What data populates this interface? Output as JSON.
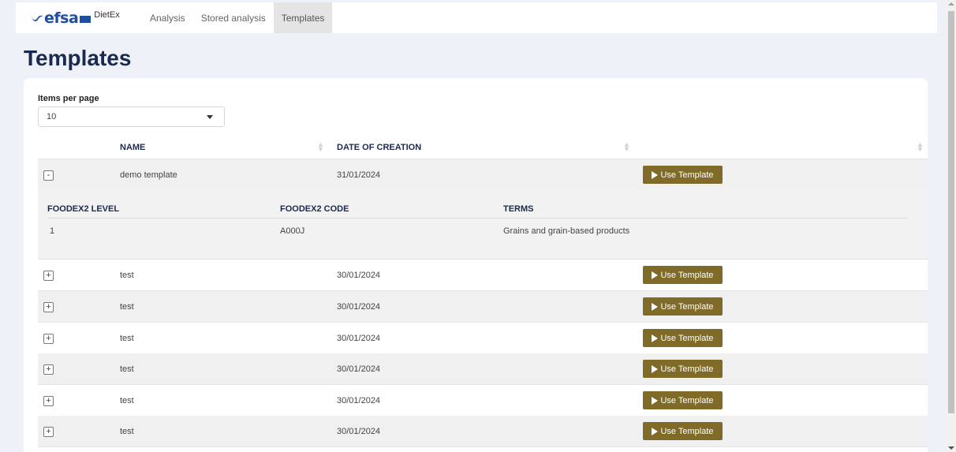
{
  "navbar": {
    "logo_text": "efsa",
    "app_name": "DietEx",
    "items": [
      {
        "label": "Analysis",
        "active": false
      },
      {
        "label": "Stored analysis",
        "active": false
      },
      {
        "label": "Templates",
        "active": true
      }
    ]
  },
  "page": {
    "title": "Templates"
  },
  "pager": {
    "label": "Items per page",
    "value": "10"
  },
  "table": {
    "columns": [
      "NAME",
      "DATE OF CREATION",
      ""
    ],
    "button_label": "Use Template",
    "rows": [
      {
        "toggle": "-",
        "name": "demo template",
        "date": "31/01/2024",
        "expanded": true
      },
      {
        "toggle": "+",
        "name": "test",
        "date": "30/01/2024",
        "expanded": false
      },
      {
        "toggle": "+",
        "name": "test",
        "date": "30/01/2024",
        "expanded": false
      },
      {
        "toggle": "+",
        "name": "test",
        "date": "30/01/2024",
        "expanded": false
      },
      {
        "toggle": "+",
        "name": "test",
        "date": "30/01/2024",
        "expanded": false
      },
      {
        "toggle": "+",
        "name": "test",
        "date": "30/01/2024",
        "expanded": false
      },
      {
        "toggle": "+",
        "name": "test",
        "date": "30/01/2024",
        "expanded": false
      }
    ]
  },
  "detail": {
    "columns": [
      "FOODEX2 LEVEL",
      "FOODEX2 CODE",
      "TERMS"
    ],
    "rows": [
      {
        "level": "1",
        "code": "A000J",
        "terms": "Grains and grain-based products"
      }
    ]
  },
  "colors": {
    "accent": "#7f6b27",
    "brand": "#1f4da0",
    "title": "#1a2a4e",
    "background": "#eef1f8"
  }
}
